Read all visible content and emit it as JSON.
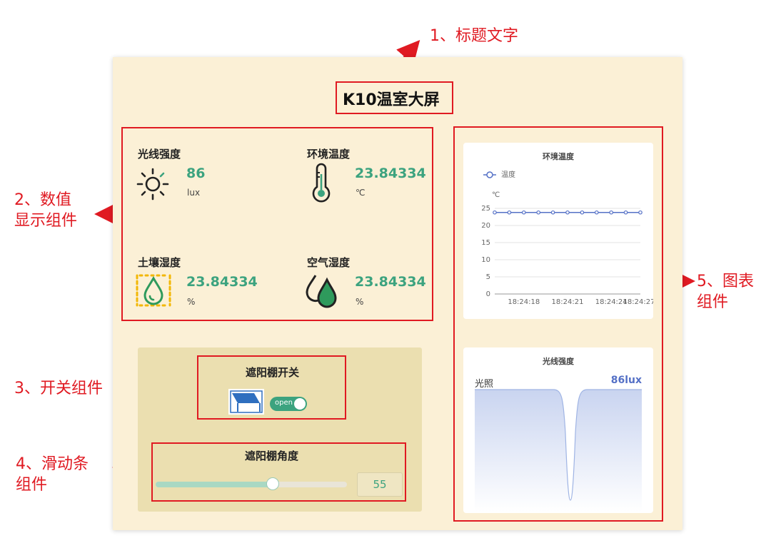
{
  "dashboard": {
    "title": "K10温室大屏",
    "metrics": [
      {
        "label": "光线强度",
        "value": "86",
        "unit": "lux",
        "icon": "sun-icon"
      },
      {
        "label": "环境温度",
        "value": "23.84334",
        "unit": "℃",
        "icon": "thermometer-icon"
      },
      {
        "label": "土壤湿度",
        "value": "23.84334",
        "unit": "%",
        "icon": "soil-moisture-icon"
      },
      {
        "label": "空气湿度",
        "value": "23.84334",
        "unit": "%",
        "icon": "air-humidity-icon"
      }
    ],
    "switch": {
      "title": "遮阳棚开关",
      "state_label": "open",
      "on": true,
      "icon": "awning-icon"
    },
    "slider": {
      "title": "遮阳棚角度",
      "value": "55",
      "min": 0,
      "max": 90
    }
  },
  "annotations": {
    "a1": "1、标题文字",
    "a2_line1": "2、数值",
    "a2_line2": "显示组件",
    "a3": "3、开关组件",
    "a4_line1": "4、滑动条",
    "a4_line2": "组件",
    "a5_line1": "5、图表",
    "a5_line2": "组件"
  },
  "chart_data": [
    {
      "type": "line",
      "title": "环境温度",
      "ylabel": "℃",
      "series": [
        {
          "name": "温度",
          "values": [
            23.8,
            23.8,
            23.8,
            23.8,
            23.8,
            23.8,
            23.8,
            23.8,
            23.8,
            23.8,
            23.8
          ]
        }
      ],
      "x": [
        "",
        "",
        "18:24:18",
        "",
        "",
        "18:24:21",
        "",
        "",
        "18:24:24",
        "",
        "18:24:27"
      ],
      "tick_labels": [
        "18:24:18",
        "18:24:21",
        "18:24:24",
        "18:24:27"
      ],
      "y_ticks": [
        "25",
        "20",
        "15",
        "10",
        "5",
        "0"
      ],
      "ylim": [
        0,
        25
      ],
      "grid": true,
      "legend": "top-left",
      "color": "#5470c6"
    },
    {
      "type": "area",
      "title": "光线强度",
      "label": "光照",
      "value_label": "86lux",
      "value": 86,
      "description_shape": "flat high value with a single sharp dip near the right third",
      "color": "#5470c6"
    }
  ],
  "colors": {
    "accent": "#3ca37f",
    "panel": "#fbf0d6",
    "annotation": "#e01a22",
    "chart_blue": "#5470c6"
  }
}
